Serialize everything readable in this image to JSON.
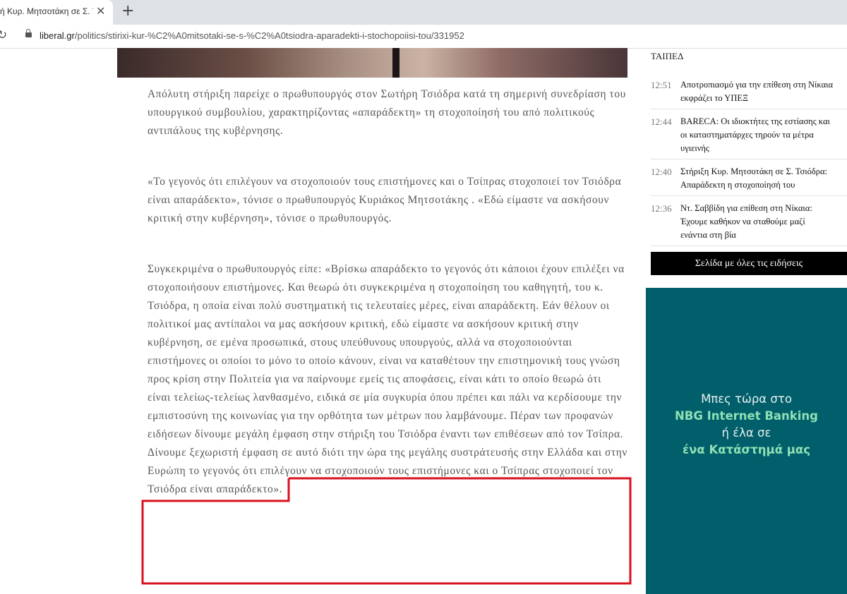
{
  "browser": {
    "tab_title": "ή Κυρ. Μητσοτάκη σε Σ. Τσιόδρα",
    "tab_close_glyph": "✕",
    "new_tab_glyph": "+",
    "reload_glyph": "↻",
    "url_host": "liberal.gr",
    "url_path": "/politics/stirixi-kur-%C2%A0mitsotaki-se-s-%C2%A0tsiodra-aparadekti-i-stochopoiisi-tou/331952"
  },
  "article": {
    "paragraphs": [
      "Απόλυτη στήριξη παρείχε ο πρωθυπουργός στον Σωτήρη Τσιόδρα κατά τη σημερινή συνεδρίαση του υπουργικού συμβουλίου, χαρακτηρίζοντας «απαράδεκτη» τη στοχοποίησή του από πολιτικούς αντιπάλους της κυβέρνησης.",
      "«Το γεγονός ότι επιλέγουν να στοχοποιούν τους επιστήμονες και ο Τσίπρας στοχοποιεί τον Τσιόδρα είναι απαράδεκτο», τόνισε ο πρωθυπουργός Κυριάκος Μητσοτάκης . «Εδώ είμαστε να ασκήσουν κριτική στην κυβέρνηση», τόνισε ο πρωθυπουργός.",
      "Συγκεκριμένα ο πρωθυπουργός είπε: «Βρίσκω απαράδεκτο το γεγονός ότι κάποιοι έχουν επιλέξει να στοχοποιήσουν επιστήμονες. Και θεωρώ ότι συγκεκριμένα η στοχοποίηση του καθηγητή, του κ. Τσιόδρα, η οποία είναι πολύ συστηματική τις τελευταίες μέρες, είναι απαράδεκτη. Εάν θέλουν οι πολιτικοί μας αντίπαλοι να μας ασκήσουν κριτική, εδώ είμαστε να ασκήσουν κριτική στην κυβέρνηση, σε εμένα προσωπικά, στους υπεύθυνους υπουργούς, αλλά να στοχοποιούνται επιστήμονες οι οποίοι το μόνο το οποίο κάνουν, είναι να καταθέτουν την επιστημονική τους γνώση προς κρίση στην Πολιτεία για να παίρνουμε εμείς τις αποφάσεις, είναι κάτι το οποίο θεωρώ ότι είναι τελείως-τελείως λανθασμένο, ειδικά σε μία συγκυρία όπου πρέπει και πάλι να κερδίσουμε την εμπιστοσύνη της κοινωνίας για την ορθότητα των μέτρων που λαμβάνουμε. Πέραν των προφανών ειδήσεων δίνουμε μεγάλη έμφαση στην στήριξη του Τσιόδρα έναντι των επιθέσεων από τον Τσίπρα.  Δίνουμε ξεχωριστή έμφαση σε αυτό διότι την ώρα της μεγάλης συστράτευσής στην Ελλάδα και στην Ευρώπη το γεγονός ότι επιλέγουν να στοχοποιούν τους επιστήμονες και ο Τσίπρας στοχοποιεί τον Τσιόδρα είναι απαράδεκτο»."
    ],
    "highlight_color": "#d8101f"
  },
  "sidebar": {
    "top_fragment": "ΤΑΙΠΕΔ",
    "news": [
      {
        "time": "12:51",
        "title_lines": [
          "Αποτροπιασμό για την επίθεση στη Νίκαια",
          "εκφράζει το ΥΠΕΞ"
        ]
      },
      {
        "time": "12:44",
        "title_lines": [
          "BARECA: Οι ιδιοκτήτες της εστίασης και",
          "οι καταστηματάρχες τηρούν τα μέτρα",
          "υγιεινής"
        ]
      },
      {
        "time": "12:40",
        "title_lines": [
          "Στήριξη Κυρ. Μητσοτάκη σε Σ. Τσιόδρα:",
          "Απαράδεκτη η στοχοποίησή του"
        ]
      },
      {
        "time": "12:36",
        "title_lines": [
          "Ντ. Σαββίδη για επίθεση στη Νίκαια:",
          "Έχουμε καθήκον να σταθούμε μαζί",
          "ενάντια στη βία"
        ]
      }
    ],
    "all_news_label": "Σελίδα με όλες τις ειδήσεις"
  },
  "ad": {
    "line1": "Μπες τώρα στο",
    "line2": "NBG Internet Banking",
    "line3": "ή έλα σε",
    "line4": "ένα Κατάστημά μας",
    "bg_color": "#005f6a",
    "accent_color": "#8fe0b5"
  }
}
